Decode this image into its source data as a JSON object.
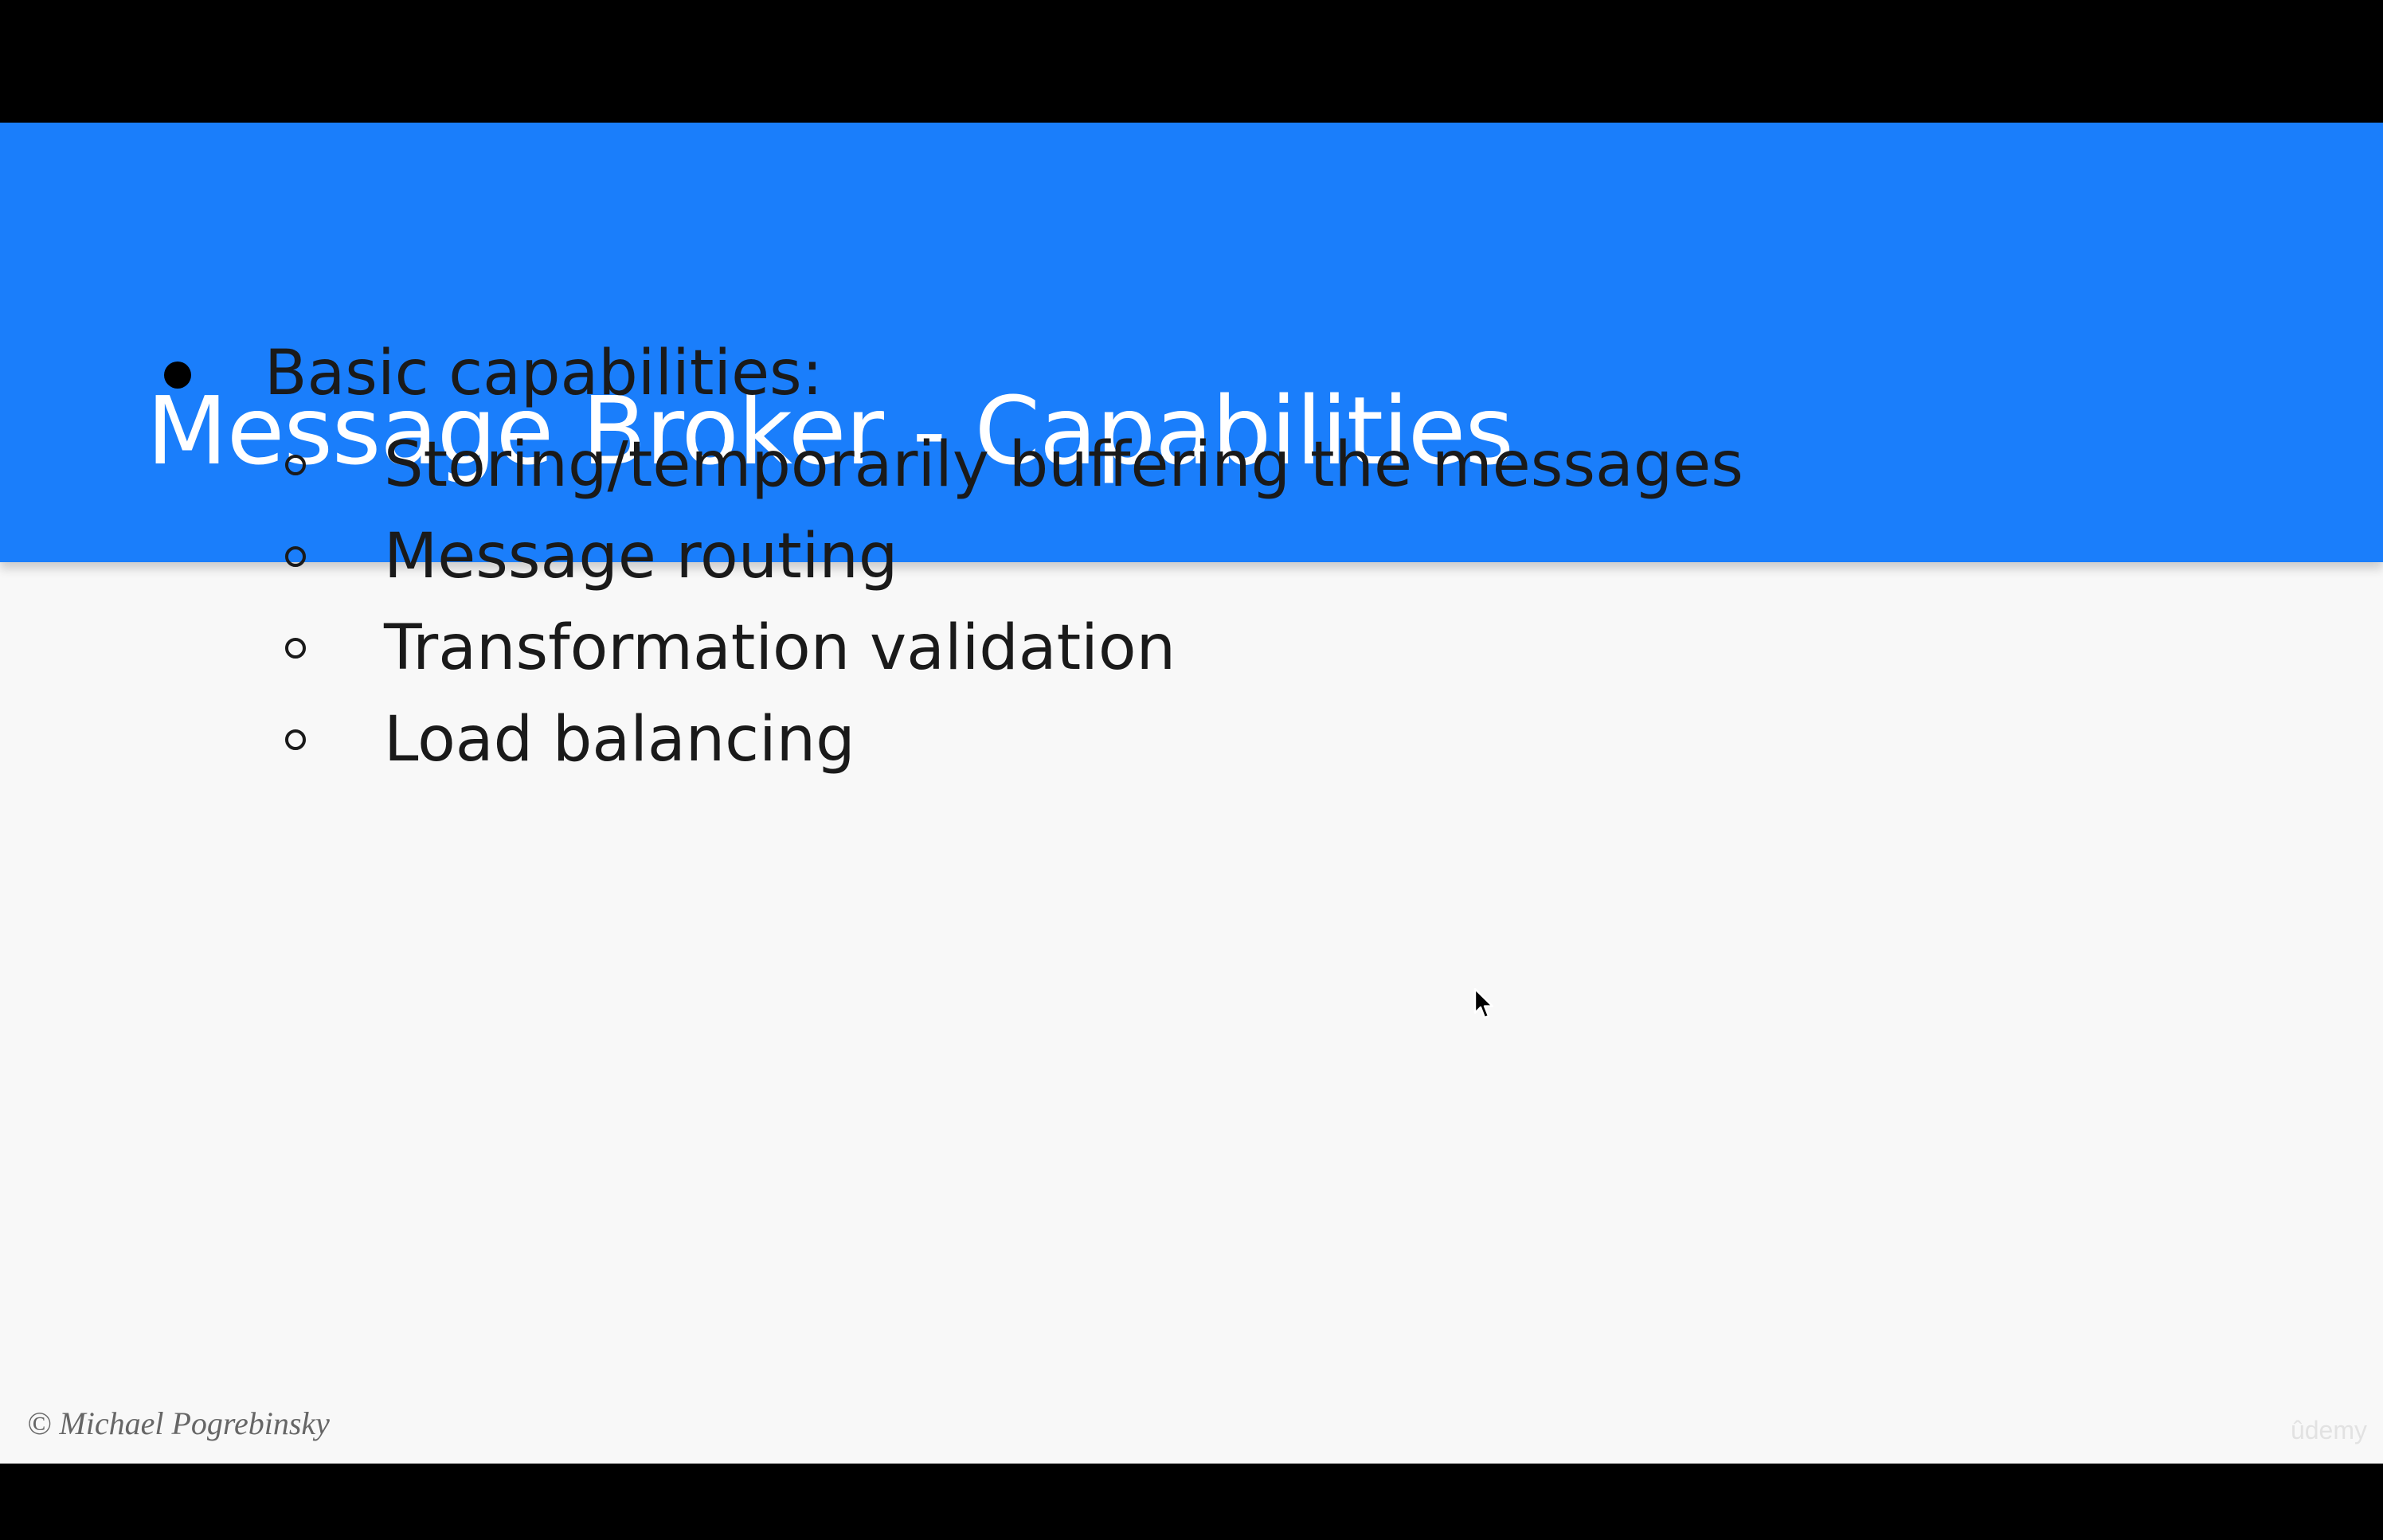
{
  "slide": {
    "title": "Message Broker - Capabilities",
    "bullets": [
      {
        "text": "Basic capabilities:",
        "sub": [
          "Storing/temporarily buffering the messages",
          "Message routing",
          "Transformation validation",
          "Load balancing"
        ]
      }
    ],
    "copyright": "© Michael Pogrebinsky",
    "watermark": "ûdemy"
  },
  "colors": {
    "header_bg": "#1a7efb",
    "slide_bg": "#f8f8f8",
    "letterbox": "#000000",
    "title_text": "#ffffff",
    "body_text": "#1a1a1a"
  },
  "icons": {
    "cursor": "mouse-pointer-icon",
    "bullet_level1": "disc",
    "bullet_level2": "circle"
  }
}
